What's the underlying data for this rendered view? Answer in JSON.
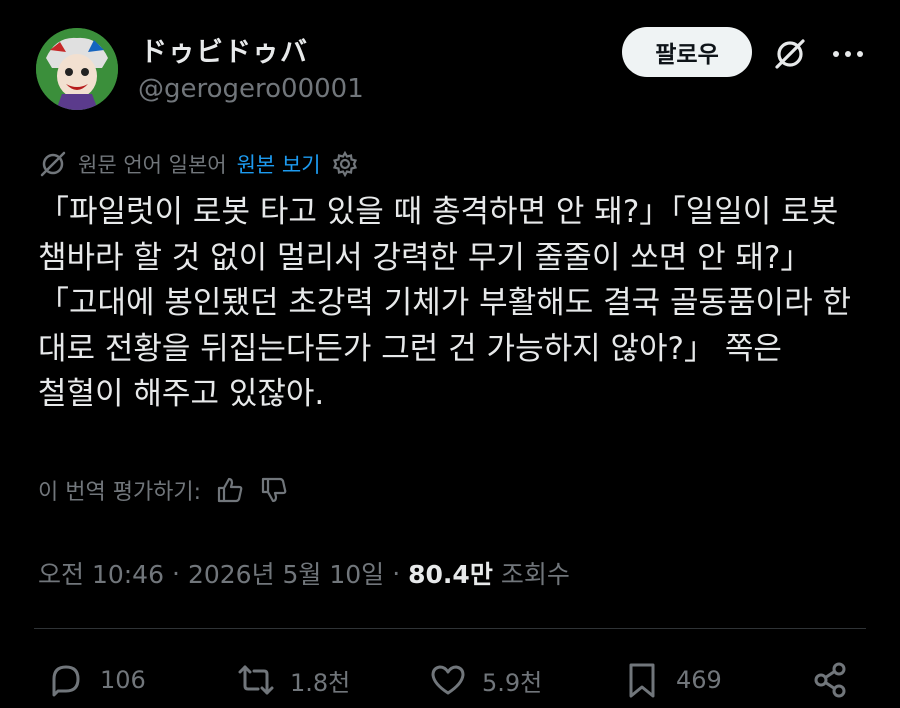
{
  "user": {
    "display_name": "ドゥビドゥバ",
    "handle": "@gerogero00001",
    "avatar_icon": "avatar-illustration"
  },
  "header": {
    "follow_label": "팔로우",
    "grok_icon": "grok-icon",
    "more_icon": "more-icon"
  },
  "translation": {
    "notice": "원문 언어 일본어",
    "show_original": "원본 보기",
    "settings_icon": "gear-icon",
    "link_color": "#1d9bf0"
  },
  "tweet": {
    "text": "「파일럿이 로봇 타고 있을 때 총격하면 안 돼?」「일일이 로봇 챔바라 할 것 없이 멀리서 강력한 무기 줄줄이 쏘면 안 돼?」「고대에 봉인됐던 초강력 기체가 부활해도 결국 골동품이라 한 대로 전황을 뒤집는다든가 그런 건 가능하지 않아?」 쪽은 철혈이 해주고 있잖아."
  },
  "rating": {
    "label": "이 번역 평가하기:"
  },
  "meta": {
    "time": "오전 10:46",
    "date": "2026년 5월 10일",
    "views_count": "80.4만",
    "views_label": "조회수"
  },
  "actions": {
    "replies": "106",
    "reposts": "1.8천",
    "likes": "5.9천",
    "bookmarks": "469"
  }
}
